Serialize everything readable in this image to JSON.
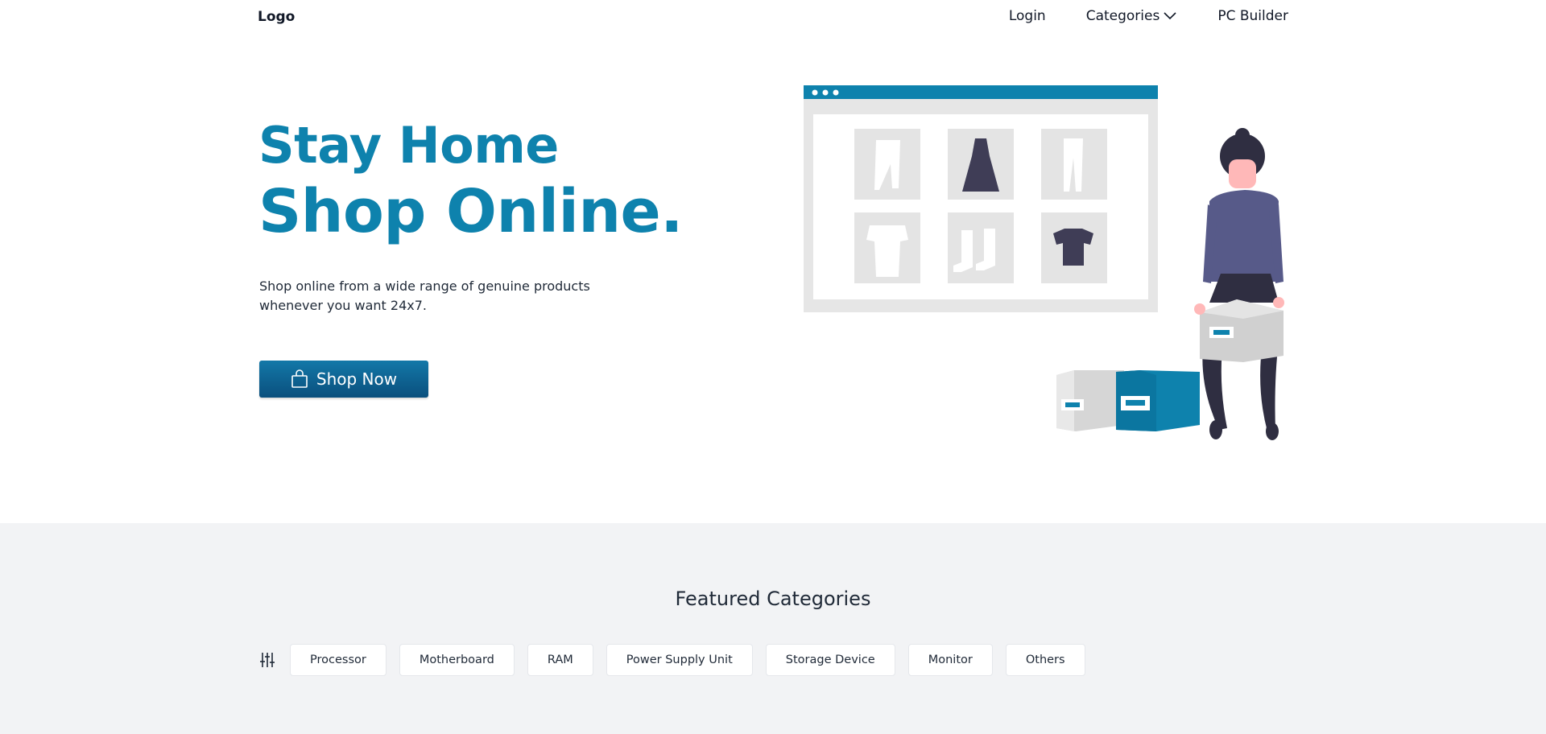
{
  "nav": {
    "logo": "Logo",
    "links": [
      {
        "label": "Login"
      },
      {
        "label": "Categories"
      },
      {
        "label": "PC Builder"
      }
    ]
  },
  "hero": {
    "title_line1": "Stay Home",
    "title_line2": "Shop Online.",
    "subtitle": "Shop online from a wide range of genuine products whenever you want 24x7.",
    "cta_label": "Shop Now",
    "accent_color": "#0e82ad",
    "button_color": "#0c5f8f"
  },
  "featured": {
    "title": "Featured Categories",
    "categories": [
      "Processor",
      "Motherboard",
      "RAM",
      "Power Supply Unit",
      "Storage Device",
      "Monitor",
      "Others"
    ]
  },
  "icons": {
    "categories_dropdown": "chevron-down-icon",
    "cta": "shopping-bag-icon",
    "filter": "sliders-icon"
  }
}
